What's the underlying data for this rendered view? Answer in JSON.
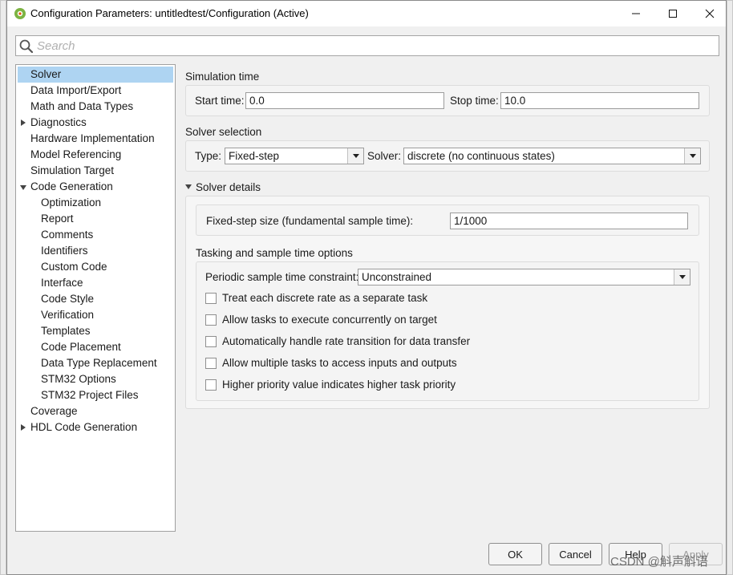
{
  "window": {
    "title": "Configuration Parameters: untitledtest/Configuration (Active)"
  },
  "search": {
    "placeholder": "Search"
  },
  "nav": {
    "items": [
      {
        "label": "Solver",
        "level": 0,
        "expander": "none",
        "selected": true
      },
      {
        "label": "Data Import/Export",
        "level": 0,
        "expander": "none"
      },
      {
        "label": "Math and Data Types",
        "level": 0,
        "expander": "none"
      },
      {
        "label": "Diagnostics",
        "level": 0,
        "expander": "collapsed"
      },
      {
        "label": "Hardware Implementation",
        "level": 0,
        "expander": "none"
      },
      {
        "label": "Model Referencing",
        "level": 0,
        "expander": "none"
      },
      {
        "label": "Simulation Target",
        "level": 0,
        "expander": "none"
      },
      {
        "label": "Code Generation",
        "level": 0,
        "expander": "expanded"
      },
      {
        "label": "Optimization",
        "level": 1,
        "expander": "none"
      },
      {
        "label": "Report",
        "level": 1,
        "expander": "none"
      },
      {
        "label": "Comments",
        "level": 1,
        "expander": "none"
      },
      {
        "label": "Identifiers",
        "level": 1,
        "expander": "none"
      },
      {
        "label": "Custom Code",
        "level": 1,
        "expander": "none"
      },
      {
        "label": "Interface",
        "level": 1,
        "expander": "none"
      },
      {
        "label": "Code Style",
        "level": 1,
        "expander": "none"
      },
      {
        "label": "Verification",
        "level": 1,
        "expander": "none"
      },
      {
        "label": "Templates",
        "level": 1,
        "expander": "none"
      },
      {
        "label": "Code Placement",
        "level": 1,
        "expander": "none"
      },
      {
        "label": "Data Type Replacement",
        "level": 1,
        "expander": "none"
      },
      {
        "label": "STM32 Options",
        "level": 1,
        "expander": "none"
      },
      {
        "label": "STM32 Project Files",
        "level": 1,
        "expander": "none"
      },
      {
        "label": "Coverage",
        "level": 0,
        "expander": "none"
      },
      {
        "label": "HDL Code Generation",
        "level": 0,
        "expander": "collapsed"
      }
    ]
  },
  "simulation_time": {
    "title": "Simulation time",
    "start_label": "Start time:",
    "start_value": "0.0",
    "stop_label": "Stop time:",
    "stop_value": "10.0"
  },
  "solver_selection": {
    "title": "Solver selection",
    "type_label": "Type:",
    "type_value": "Fixed-step",
    "solver_label": "Solver:",
    "solver_value": "discrete (no continuous states)"
  },
  "solver_details": {
    "title": "Solver details",
    "step_label": "Fixed-step size (fundamental sample time):",
    "step_value": "1/1000"
  },
  "tasking": {
    "title": "Tasking and sample time options",
    "constraint_label": "Periodic sample time constraint:",
    "constraint_value": "Unconstrained",
    "checkboxes": [
      {
        "label": "Treat each discrete rate as a separate task",
        "checked": false
      },
      {
        "label": "Allow tasks to execute concurrently on target",
        "checked": false
      },
      {
        "label": "Automatically handle rate transition for data transfer",
        "checked": false
      },
      {
        "label": "Allow multiple tasks to access inputs and outputs",
        "checked": false
      },
      {
        "label": "Higher priority value indicates higher task priority",
        "checked": false
      }
    ]
  },
  "buttons": {
    "ok": "OK",
    "cancel": "Cancel",
    "help": "Help",
    "apply": "Apply"
  },
  "watermark": "CSDN @斛声斛语",
  "colors": {
    "selection": "#aed4f2",
    "window_bg": "#f0f0f0",
    "panel_bg": "#f4f4f4"
  }
}
